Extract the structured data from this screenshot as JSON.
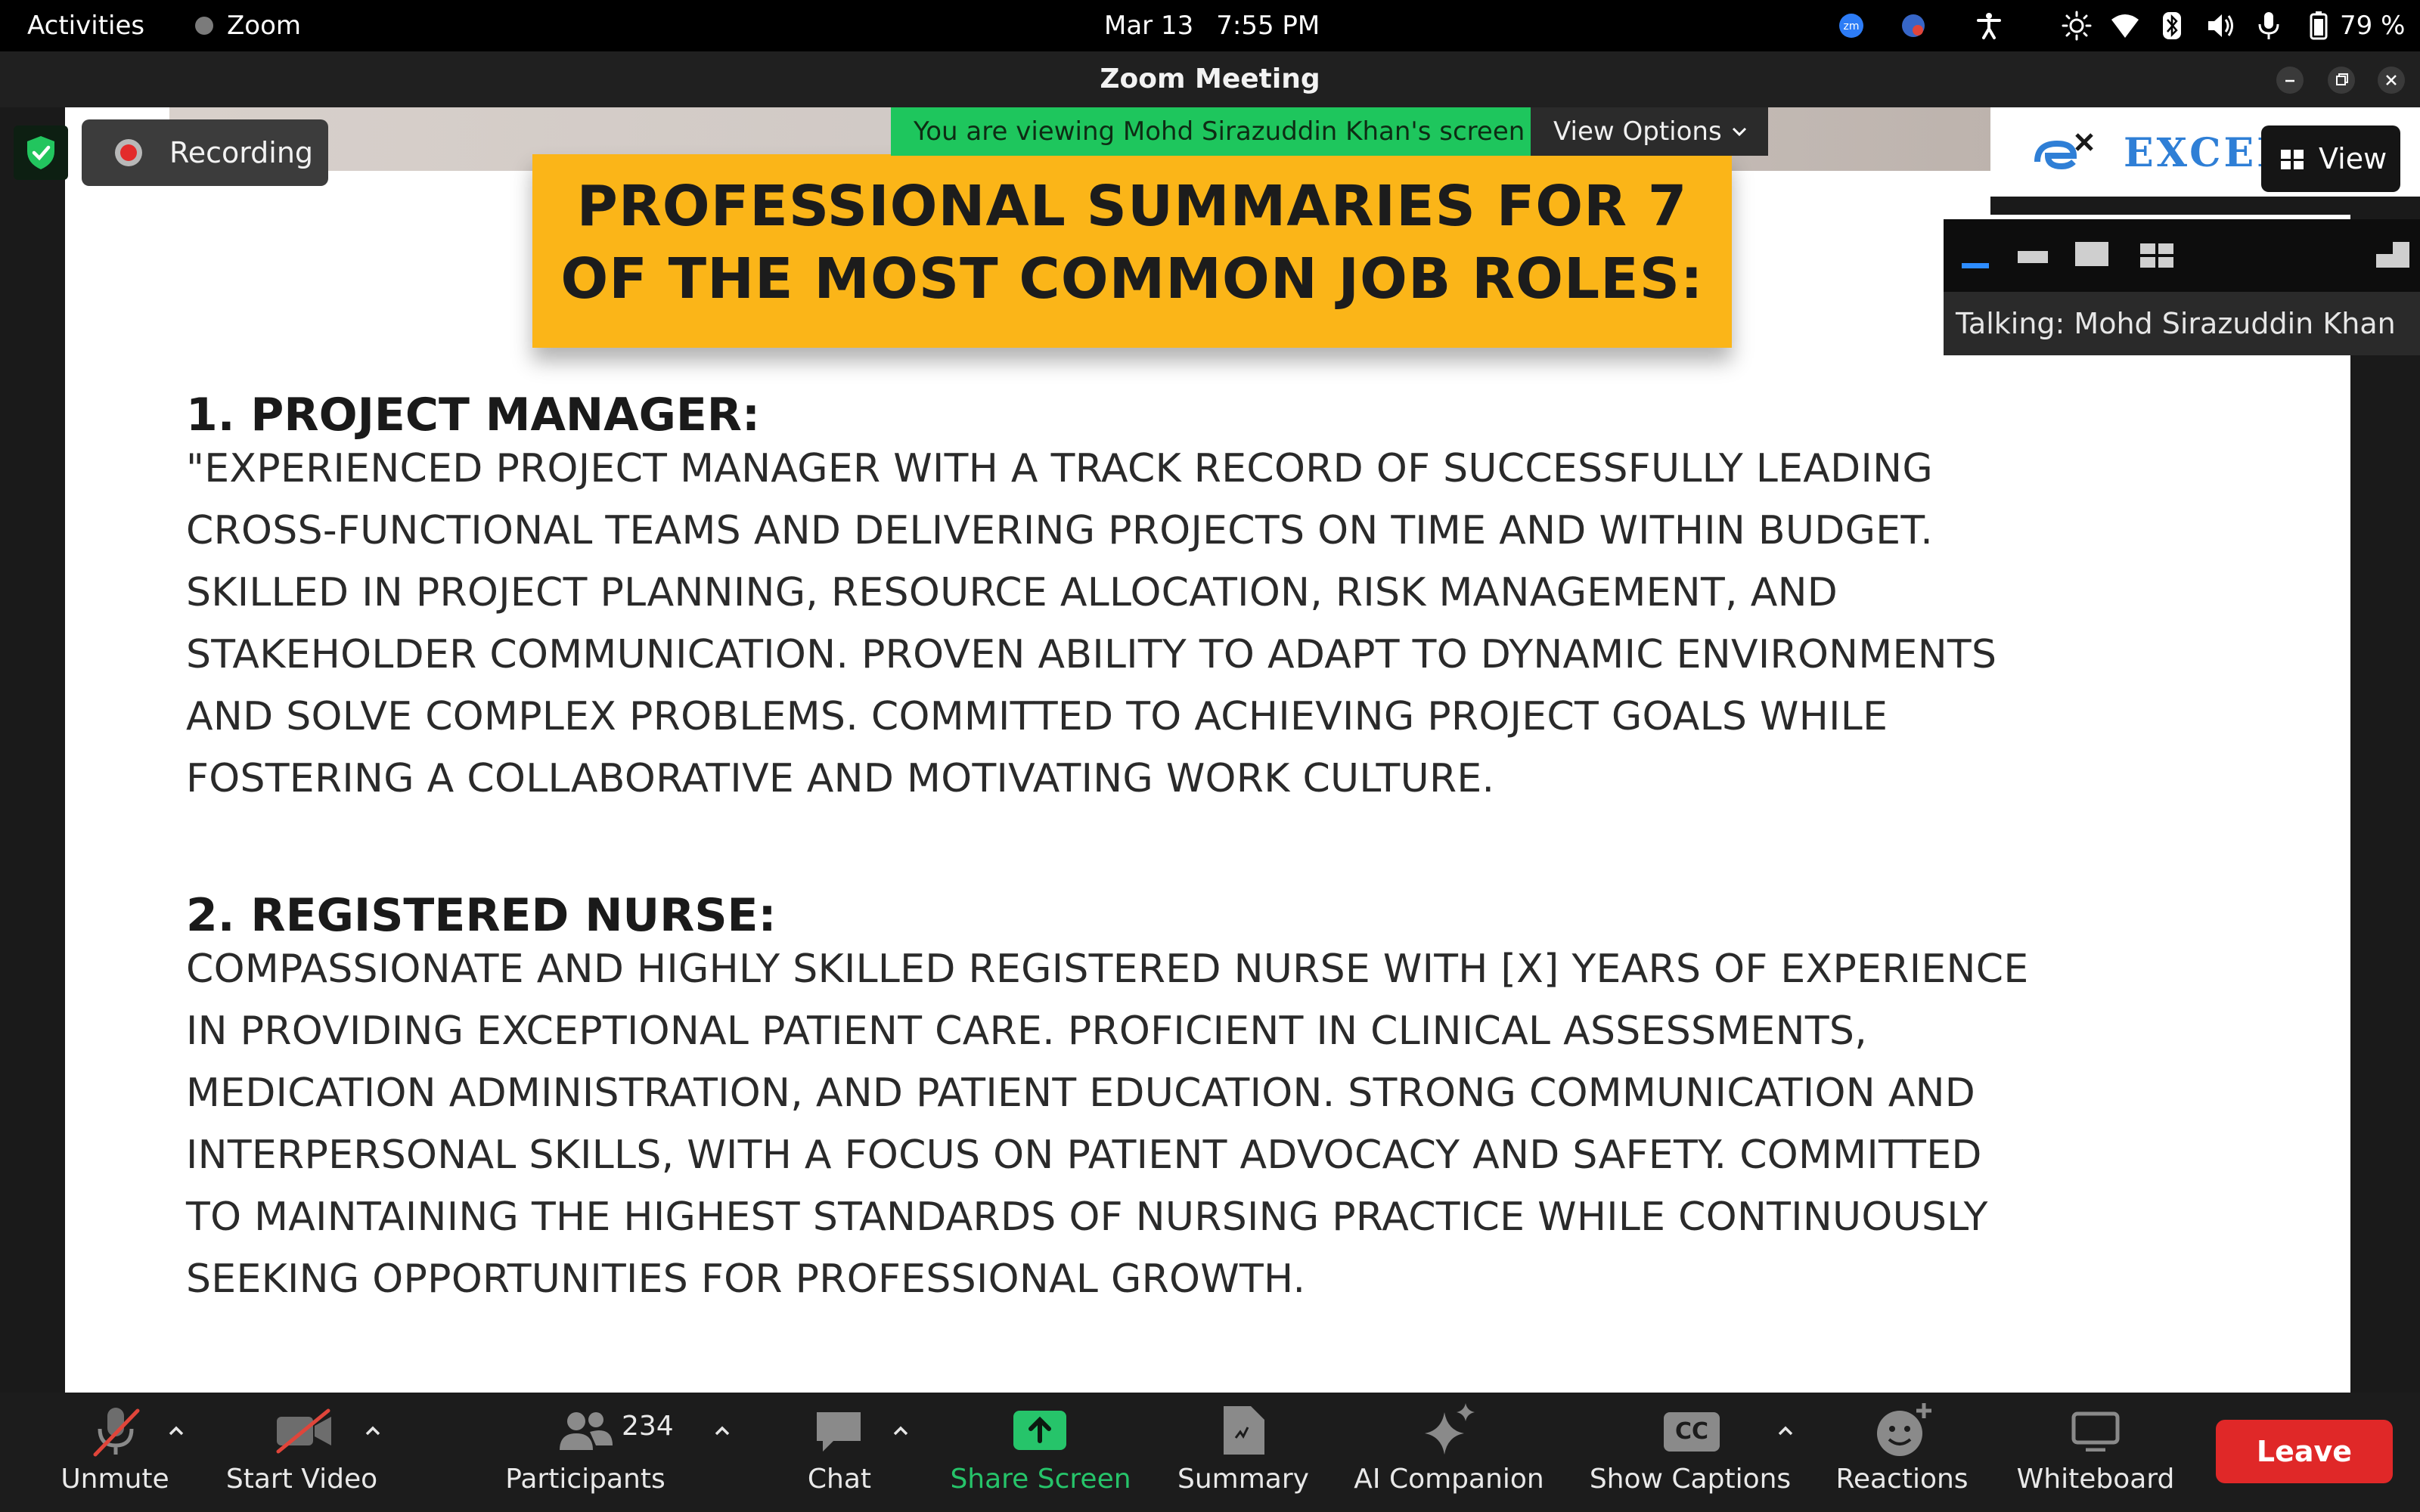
{
  "system_bar": {
    "activities": "Activities",
    "app_name": "Zoom",
    "date": "Mar 13",
    "time": "7:55 PM",
    "battery": "79 %",
    "icons": [
      "zoom-tray-icon",
      "chrome-tray-icon",
      "accessibility-icon",
      "brightness-icon",
      "wifi-icon",
      "bluetooth-icon",
      "volume-icon",
      "microphone-icon",
      "battery-icon"
    ]
  },
  "window": {
    "title": "Zoom Meeting",
    "controls": [
      "minimize-icon",
      "restore-icon",
      "close-icon"
    ]
  },
  "share": {
    "viewing_text": "You are viewing Mohd Sirazuddin Khan's screen",
    "view_options_label": "View Options",
    "recording_label": "Recording",
    "view_button_label": "View",
    "talking_label": "Talking: Mohd Sirazuddin Khan",
    "thumbnail_logo_text": "EXCEL"
  },
  "slide": {
    "title_lines": [
      "PROFESSIONAL SUMMARIES FOR 7",
      "OF THE MOST COMMON JOB ROLES:"
    ],
    "sections": [
      {
        "heading": "1. PROJECT MANAGER:",
        "lines": [
          "\"EXPERIENCED PROJECT MANAGER WITH A TRACK RECORD OF SUCCESSFULLY LEADING",
          "CROSS-FUNCTIONAL TEAMS AND DELIVERING PROJECTS ON TIME AND WITHIN BUDGET.",
          "SKILLED IN PROJECT PLANNING, RESOURCE ALLOCATION, RISK MANAGEMENT, AND",
          "STAKEHOLDER COMMUNICATION. PROVEN ABILITY TO ADAPT TO DYNAMIC ENVIRONMENTS",
          "AND SOLVE COMPLEX PROBLEMS. COMMITTED TO ACHIEVING PROJECT GOALS WHILE",
          "FOSTERING A COLLABORATIVE AND MOTIVATING WORK CULTURE."
        ]
      },
      {
        "heading": "2. REGISTERED NURSE:",
        "lines": [
          "COMPASSIONATE AND HIGHLY SKILLED REGISTERED NURSE WITH [X] YEARS OF EXPERIENCE",
          "IN PROVIDING EXCEPTIONAL PATIENT CARE. PROFICIENT IN CLINICAL ASSESSMENTS,",
          "MEDICATION ADMINISTRATION, AND PATIENT EDUCATION. STRONG COMMUNICATION AND",
          "INTERPERSONAL SKILLS, WITH A FOCUS ON PATIENT ADVOCACY AND SAFETY. COMMITTED",
          "TO MAINTAINING THE HIGHEST STANDARDS OF NURSING PRACTICE WHILE CONTINUOUSLY",
          "SEEKING OPPORTUNITIES FOR PROFESSIONAL GROWTH."
        ]
      }
    ]
  },
  "toolbar": {
    "unmute": "Unmute",
    "start_video": "Start Video",
    "participants": "Participants",
    "participants_count": "234",
    "chat": "Chat",
    "share_screen": "Share Screen",
    "summary": "Summary",
    "ai_companion": "AI Companion",
    "show_captions": "Show Captions",
    "cc_badge": "CC",
    "reactions": "Reactions",
    "whiteboard": "Whiteboard",
    "leave": "Leave"
  },
  "colors": {
    "share_banner": "#1ec65d",
    "share_screen_green": "#26c46a",
    "leave_red": "#e02828",
    "slide_banner_yellow": "#fbb518",
    "mute_slash_red": "#e0453a"
  }
}
